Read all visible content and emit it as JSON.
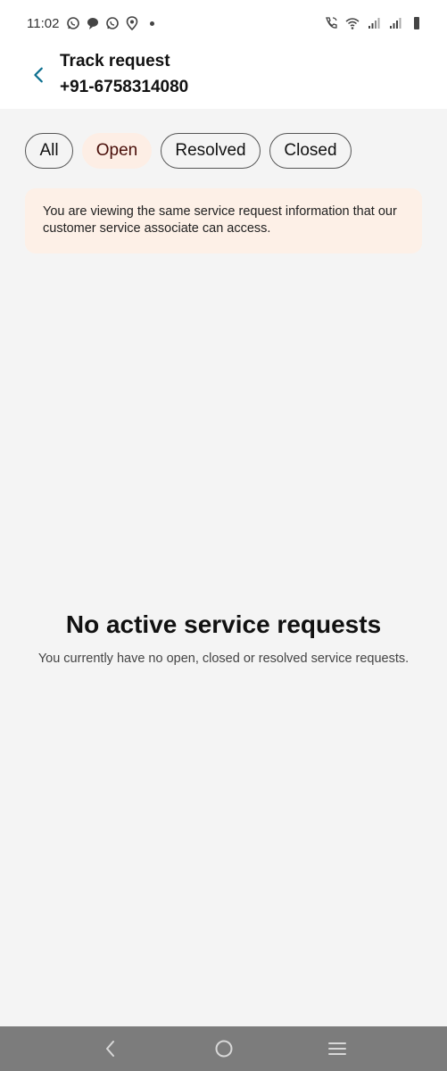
{
  "status_bar": {
    "time": "11:02",
    "left_icons": [
      "whatsapp-icon",
      "chat-bubble-icon",
      "whatsapp-business-icon",
      "location-icon",
      "dot-icon"
    ],
    "right_icons": [
      "wifi-calling-icon",
      "wifi-icon",
      "signal-icon",
      "signal-icon",
      "battery-icon"
    ]
  },
  "header": {
    "title": "Track request",
    "subtitle": "+91-6758314080",
    "back_icon": "chevron-left-icon"
  },
  "filters": {
    "all": "All",
    "open": "Open",
    "resolved": "Resolved",
    "closed": "Closed",
    "selected": "Open"
  },
  "info_banner": {
    "text": "You are viewing the same service request information that our customer service associate can access."
  },
  "empty_state": {
    "title": "No active service requests",
    "subtitle": "You currently have no open, closed or resolved service requests."
  },
  "nav_bar": {
    "icons": [
      "back-nav-icon",
      "home-nav-icon",
      "recents-nav-icon"
    ]
  },
  "colors": {
    "accent": "#0b6f8f",
    "chip_active_bg": "#fdeee5",
    "banner_bg": "#fdf0e7",
    "page_bg": "#f4f4f4",
    "nav_bar": "#7c7c7c"
  }
}
